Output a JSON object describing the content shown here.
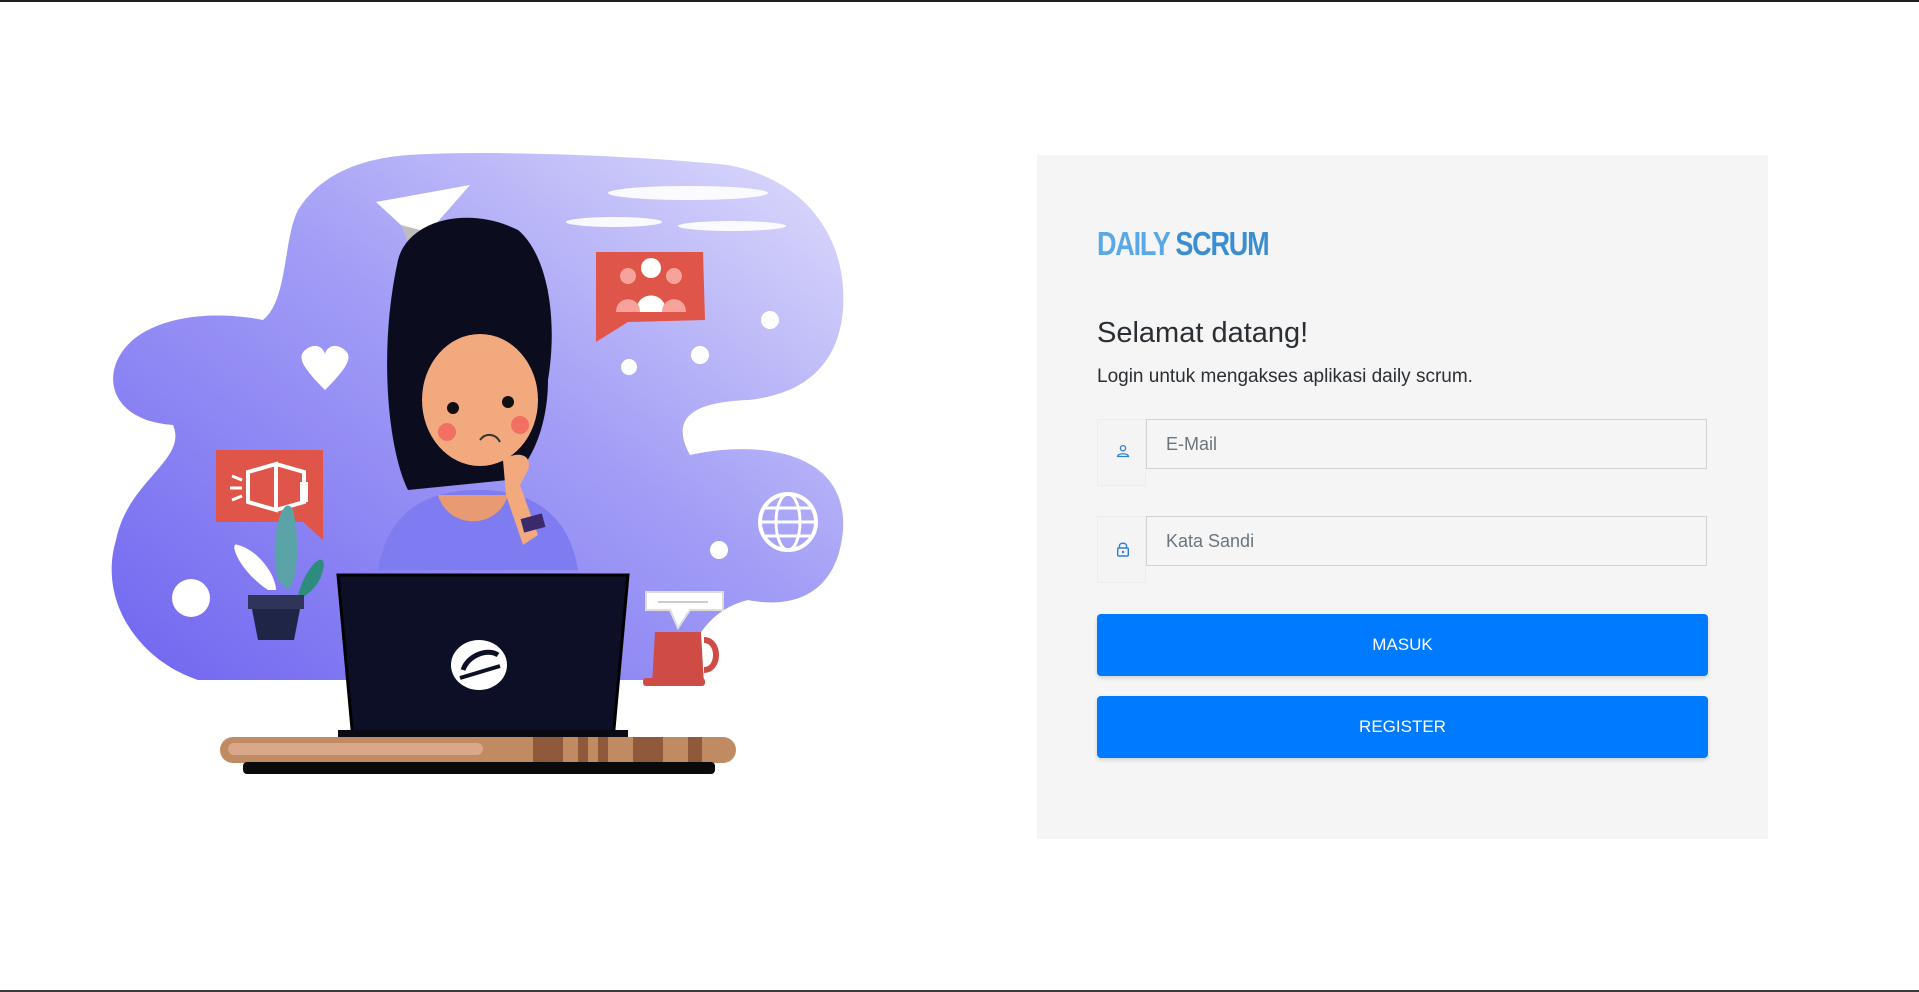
{
  "brand": {
    "part1": "DAILY",
    "part2": "SCRUM"
  },
  "login": {
    "welcome": "Selamat datang!",
    "subtitle": "Login untuk mengakses aplikasi daily scrum.",
    "email_placeholder": "E-Mail",
    "password_placeholder": "Kata Sandi",
    "login_button": "MASUK",
    "register_button": "REGISTER"
  },
  "icons": {
    "email": "user-icon",
    "password": "lock-icon"
  },
  "colors": {
    "primary": "#007bff",
    "card_bg": "#f5f5f5",
    "brand_light": "#5aa9e6",
    "brand_dark": "#3b8fd0",
    "blob": "#9b97f7"
  }
}
